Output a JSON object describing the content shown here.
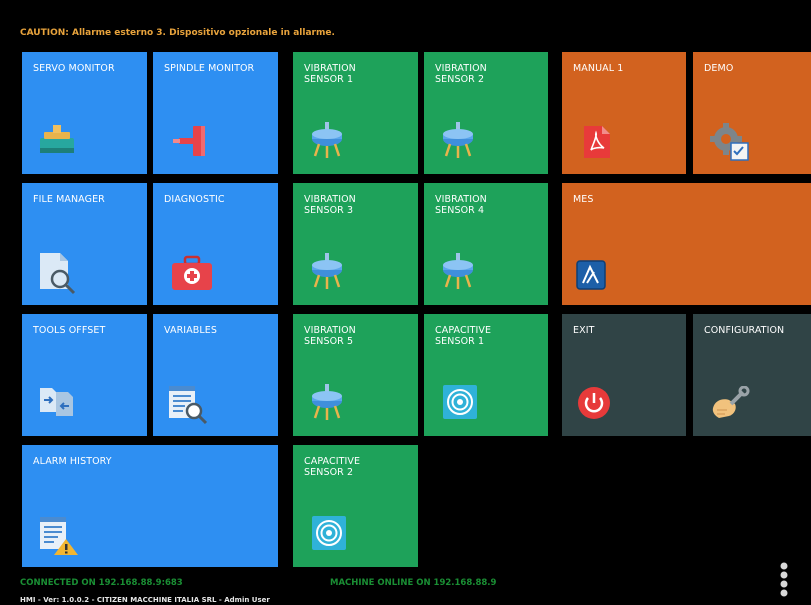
{
  "caution_text": "CAUTION: Allarme esterno 3. Dispositivo opzionale in allarme.",
  "tiles": {
    "servo_monitor": "SERVO MONITOR",
    "spindle_monitor": "SPINDLE MONITOR",
    "vibration_sensor_1": "VIBRATION\nSENSOR 1",
    "vibration_sensor_2": "VIBRATION\nSENSOR 2",
    "manual_1": "MANUAL 1",
    "demo": "DEMO",
    "file_manager": "FILE MANAGER",
    "diagnostic": "DIAGNOSTIC",
    "vibration_sensor_3": "VIBRATION\nSENSOR 3",
    "vibration_sensor_4": "VIBRATION\nSENSOR 4",
    "mes": "MES",
    "tools_offset": "TOOLS OFFSET",
    "variables": "VARIABLES",
    "vibration_sensor_5": "VIBRATION\nSENSOR 5",
    "capacitive_sensor_1": "CAPACITIVE\nSENSOR 1",
    "exit": "EXIT",
    "configuration": "CONFIGURATION",
    "alarm_history": "ALARM HISTORY",
    "capacitive_sensor_2": "CAPACITIVE\nSENSOR 2"
  },
  "status": {
    "connected": "CONNECTED ON 192.168.88.9:683",
    "machine_online": "MACHINE ONLINE ON 192.168.88.9"
  },
  "footer_text": "HMI - Ver: 1.0.0.2 - CITIZEN MACCHINE ITALIA SRL - Admin User",
  "colors": {
    "tile_blue": "#2e8ff2",
    "tile_green": "#1ea25a",
    "tile_orange": "#d2621f",
    "tile_slate": "#304446",
    "caution": "#e8a33c",
    "status_green": "#1a8f34"
  },
  "icons": {
    "servo_monitor": "servo-motor-icon",
    "spindle_monitor": "spindle-icon",
    "vibration": "vibration-sensor-icon",
    "manual_1": "pdf-icon",
    "demo": "gear-checklist-icon",
    "file_manager": "file-search-icon",
    "diagnostic": "first-aid-kit-icon",
    "mes": "mes-logo-icon",
    "tools_offset": "transfer-icon",
    "variables": "document-search-icon",
    "capacitive": "capacitive-sensor-icon",
    "exit": "power-icon",
    "configuration": "wrench-hand-icon",
    "alarm_history": "document-warning-icon",
    "menu": "more-vertical-icon"
  }
}
